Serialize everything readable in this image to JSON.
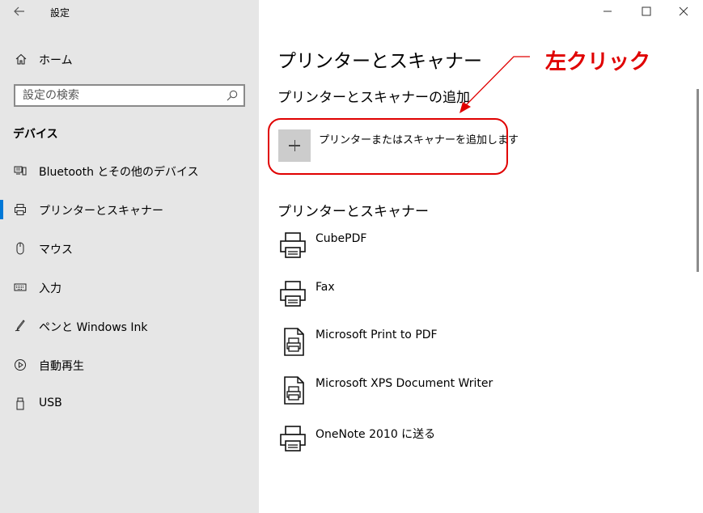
{
  "window": {
    "title": "設定",
    "back_icon": "arrow-left-icon",
    "controls": [
      "minimize-icon",
      "maximize-icon",
      "close-icon"
    ]
  },
  "sidebar": {
    "home_label": "ホーム",
    "search": {
      "placeholder": "設定の検索"
    },
    "section_title": "デバイス",
    "items": [
      {
        "label": "Bluetooth とその他のデバイス",
        "icon": "bluetooth-devices-icon"
      },
      {
        "label": "プリンターとスキャナー",
        "icon": "printer-icon",
        "active": true
      },
      {
        "label": "マウス",
        "icon": "mouse-icon"
      },
      {
        "label": "入力",
        "icon": "keyboard-icon"
      },
      {
        "label": "ペンと Windows Ink",
        "icon": "pen-icon"
      },
      {
        "label": "自動再生",
        "icon": "autoplay-icon"
      },
      {
        "label": "USB",
        "icon": "usb-icon"
      }
    ],
    "accent_color": "#0078d7"
  },
  "main": {
    "title": "プリンターとスキャナー",
    "add_section_title": "プリンターとスキャナーの追加",
    "add_label": "プリンターまたはスキャナーを追加します",
    "list_title": "プリンターとスキャナー",
    "printers": [
      {
        "name": "CubePDF",
        "icon": "printer-icon"
      },
      {
        "name": "Fax",
        "icon": "printer-icon"
      },
      {
        "name": "Microsoft Print to PDF",
        "icon": "document-printer-icon"
      },
      {
        "name": "Microsoft XPS Document Writer",
        "icon": "document-printer-icon"
      },
      {
        "name": "OneNote 2010 に送る",
        "icon": "printer-icon"
      }
    ]
  },
  "annotation": {
    "text": "左クリック",
    "color": "#e00000"
  }
}
